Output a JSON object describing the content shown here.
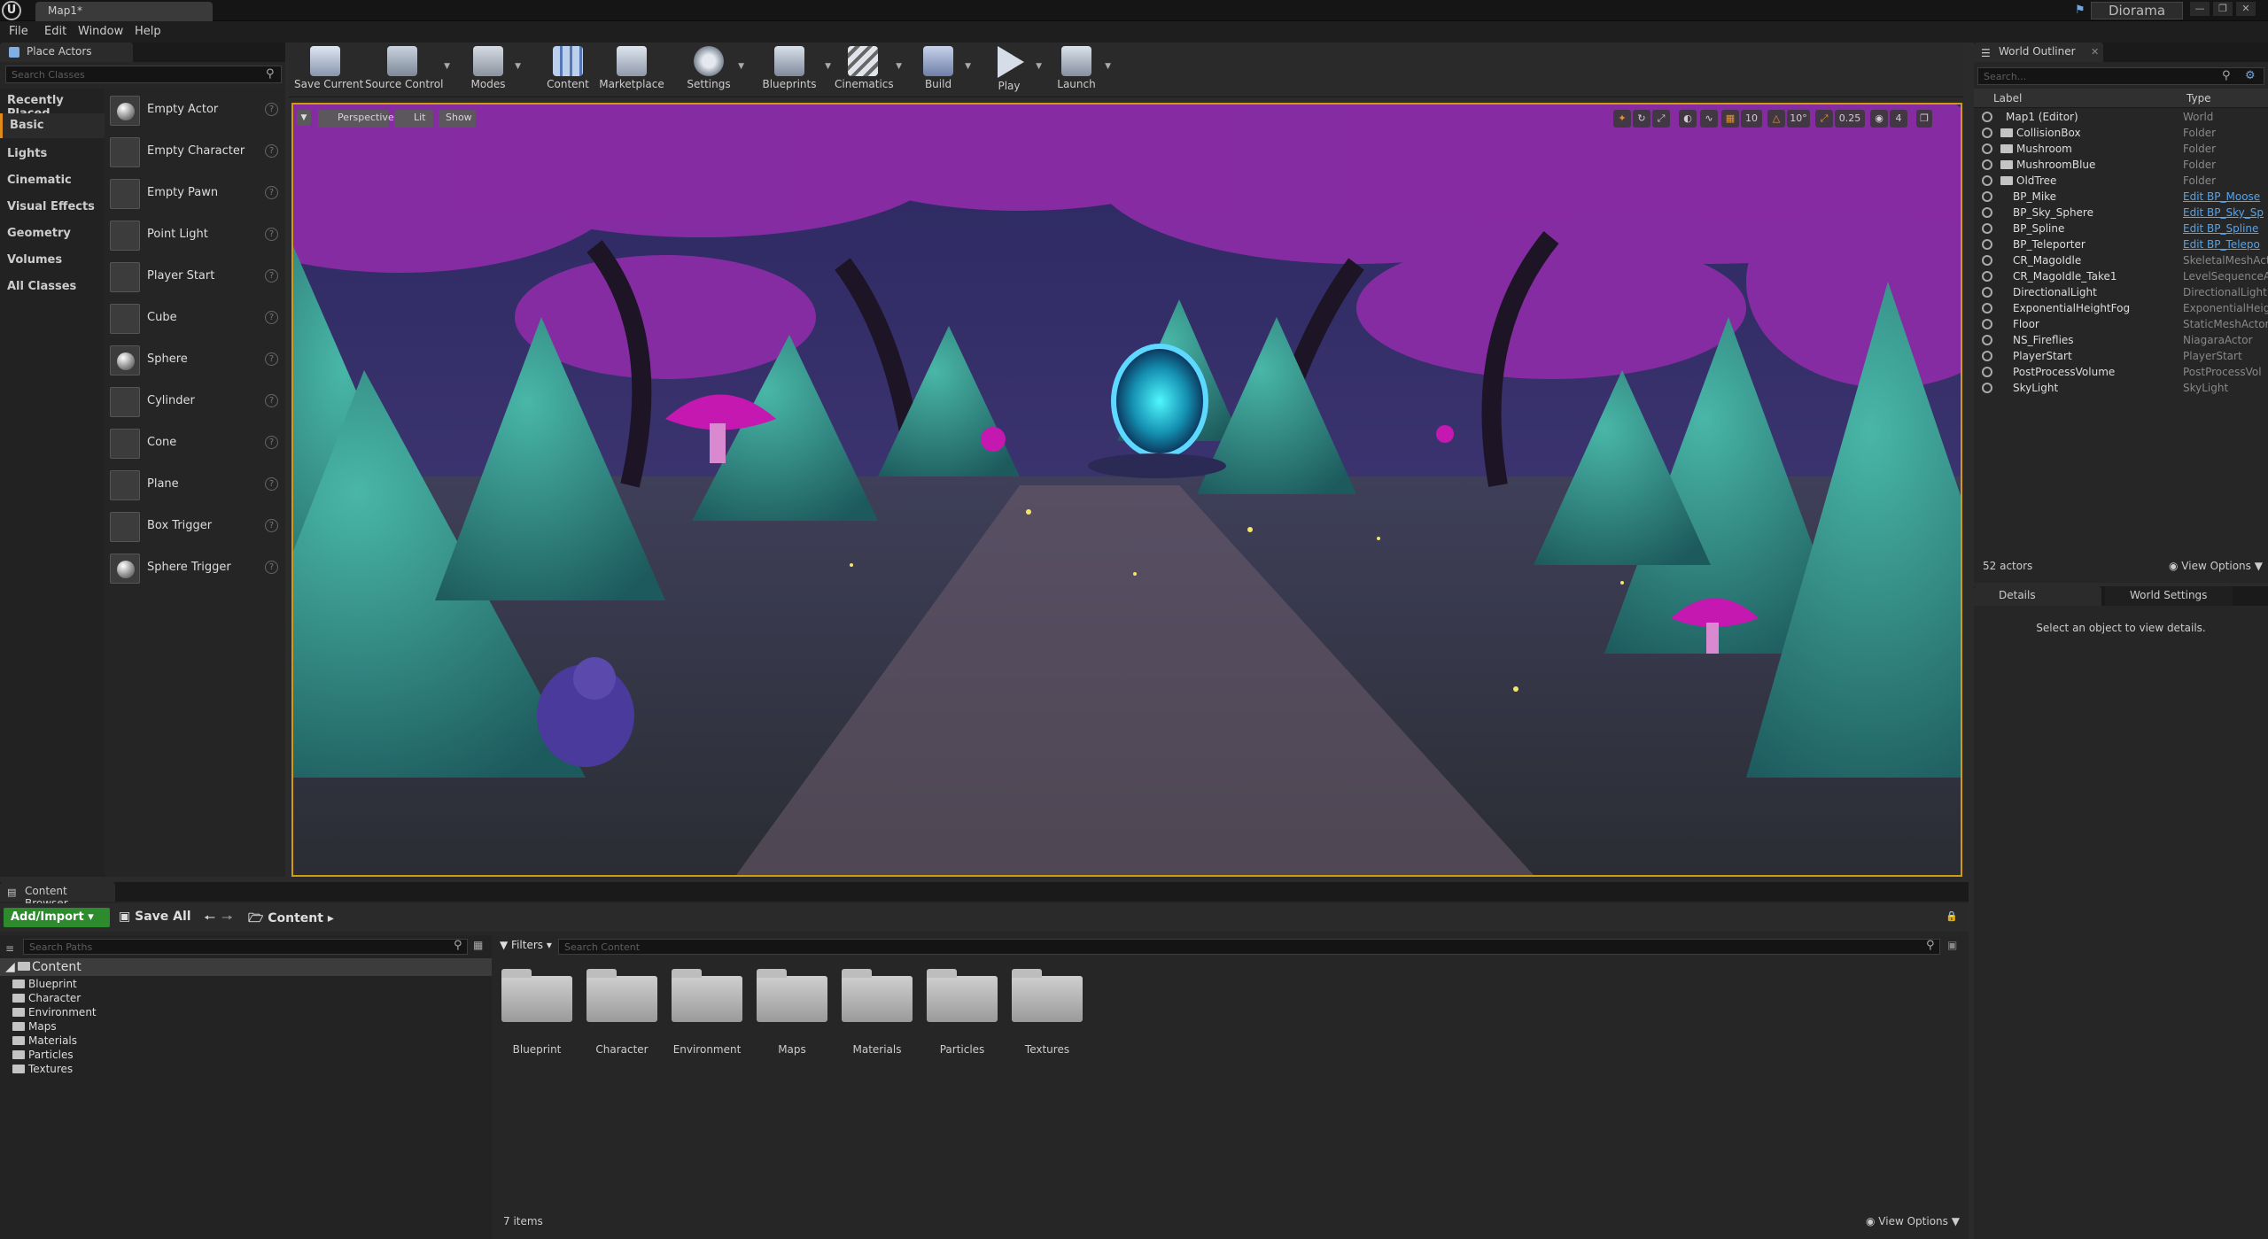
{
  "window": {
    "doc_tab": "Map1*",
    "project": "Diorama"
  },
  "menu": [
    "File",
    "Edit",
    "Window",
    "Help"
  ],
  "place_actors": {
    "title": "Place Actors",
    "search_placeholder": "Search Classes",
    "categories": [
      "Recently Placed",
      "Basic",
      "Lights",
      "Cinematic",
      "Visual Effects",
      "Geometry",
      "Volumes",
      "All Classes"
    ],
    "selected_category": "Basic",
    "items": [
      "Empty Actor",
      "Empty Character",
      "Empty Pawn",
      "Point Light",
      "Player Start",
      "Cube",
      "Sphere",
      "Cylinder",
      "Cone",
      "Plane",
      "Box Trigger",
      "Sphere Trigger"
    ]
  },
  "toolbar": {
    "buttons": [
      "Save Current",
      "Source Control",
      "Modes",
      "Content",
      "Marketplace",
      "Settings",
      "Blueprints",
      "Cinematics",
      "Build",
      "Play",
      "Launch"
    ]
  },
  "viewport": {
    "perspective": "Perspective",
    "lit": "Lit",
    "show": "Show",
    "grid_snap": "10",
    "rot_snap": "10°",
    "scale_snap": "0.25",
    "cam_speed": "4"
  },
  "outliner": {
    "title": "World Outliner",
    "search_placeholder": "Search...",
    "col_label": "Label",
    "col_type": "Type",
    "rows": [
      {
        "label": "Map1 (Editor)",
        "type": "World"
      },
      {
        "label": "CollisionBox",
        "type": "Folder"
      },
      {
        "label": "Mushroom",
        "type": "Folder"
      },
      {
        "label": "MushroomBlue",
        "type": "Folder"
      },
      {
        "label": "OldTree",
        "type": "Folder"
      },
      {
        "label": "BP_Mike",
        "type": "Edit BP_Moose"
      },
      {
        "label": "BP_Sky_Sphere",
        "type": "Edit BP_Sky_Sp"
      },
      {
        "label": "BP_Spline",
        "type": "Edit BP_Spline"
      },
      {
        "label": "BP_Teleporter",
        "type": "Edit BP_Telepo"
      },
      {
        "label": "CR_MagoIdle",
        "type": "SkeletalMeshAct"
      },
      {
        "label": "CR_MagoIdle_Take1",
        "type": "LevelSequenceA"
      },
      {
        "label": "DirectionalLight",
        "type": "DirectionalLight"
      },
      {
        "label": "ExponentialHeightFog",
        "type": "ExponentialHeig"
      },
      {
        "label": "Floor",
        "type": "StaticMeshActor"
      },
      {
        "label": "NS_Fireflies",
        "type": "NiagaraActor"
      },
      {
        "label": "PlayerStart",
        "type": "PlayerStart"
      },
      {
        "label": "PostProcessVolume",
        "type": "PostProcessVol"
      },
      {
        "label": "SkyLight",
        "type": "SkyLight"
      }
    ],
    "actor_count": "52 actors",
    "view_options": "View Options"
  },
  "details": {
    "tab1": "Details",
    "tab2": "World Settings",
    "empty_msg": "Select an object to view details."
  },
  "content_browser": {
    "title": "Content Browser",
    "add_import": "Add/Import",
    "save_all": "Save All",
    "path": "Content",
    "search_paths": "Search Paths",
    "filters": "Filters",
    "search_content": "Search Content",
    "tree_root": "Content",
    "tree": [
      "Blueprint",
      "Character",
      "Environment",
      "Maps",
      "Materials",
      "Particles",
      "Textures"
    ],
    "folders": [
      "Blueprint",
      "Character",
      "Environment",
      "Maps",
      "Materials",
      "Particles",
      "Textures"
    ],
    "item_count": "7 items",
    "view_options": "View Options"
  },
  "colors": {
    "accent": "#d19a15",
    "add_green": "#2d8a2d",
    "link_blue": "#4ea5f5"
  }
}
